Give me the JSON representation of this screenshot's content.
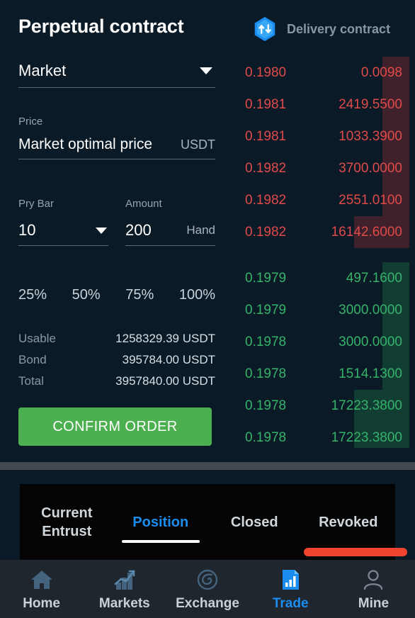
{
  "header": {
    "title": "Perpetual contract",
    "delivery_label": "Delivery contract",
    "delivery_icon": "swap-hexagon-icon",
    "accent_blue": "#1b8df0"
  },
  "form": {
    "order_type": {
      "label": "order-type",
      "value": "Market",
      "caret_icon": "chevron-down-icon"
    },
    "price": {
      "label": "Price",
      "value": "Market optimal price",
      "unit": "USDT"
    },
    "leverage": {
      "label": "Pry Bar",
      "value": "10",
      "caret_icon": "chevron-down-icon"
    },
    "amount": {
      "label": "Amount",
      "value": "200",
      "unit": "Hand"
    },
    "percent_options": [
      "25%",
      "50%",
      "75%",
      "100%"
    ],
    "balances": [
      {
        "key": "Usable",
        "value": "1258329.39 USDT"
      },
      {
        "key": "Bond",
        "value": "395784.00 USDT"
      },
      {
        "key": "Total",
        "value": "3957840.00 USDT"
      }
    ],
    "confirm_label": "CONFIRM ORDER",
    "confirm_color": "#4caf50"
  },
  "orderbook": {
    "ask_color": "#e04a4a",
    "bid_color": "#35b36a",
    "asks": [
      {
        "price": "0.1980",
        "amount": "0.0098"
      },
      {
        "price": "0.1981",
        "amount": "2419.5500"
      },
      {
        "price": "0.1981",
        "amount": "1033.3900"
      },
      {
        "price": "0.1982",
        "amount": "3700.0000"
      },
      {
        "price": "0.1982",
        "amount": "2551.0100"
      },
      {
        "price": "0.1982",
        "amount": "16142.6000"
      }
    ],
    "bids": [
      {
        "price": "0.1979",
        "amount": "497.1600"
      },
      {
        "price": "0.1979",
        "amount": "3000.0000"
      },
      {
        "price": "0.1978",
        "amount": "3000.0000"
      },
      {
        "price": "0.1978",
        "amount": "1514.1300"
      },
      {
        "price": "0.1978",
        "amount": "17223.3800"
      },
      {
        "price": "0.1978",
        "amount": "17223.3800"
      }
    ]
  },
  "order_tabs": [
    {
      "label": "Current Entrust",
      "active": false
    },
    {
      "label": "Position",
      "active": true
    },
    {
      "label": "Closed",
      "active": false
    },
    {
      "label": "Revoked",
      "active": false
    }
  ],
  "bottom_nav": [
    {
      "label": "Home",
      "icon": "home-icon",
      "active": false
    },
    {
      "label": "Markets",
      "icon": "chart-bars-icon",
      "active": false
    },
    {
      "label": "Exchange",
      "icon": "swirl-icon",
      "active": false
    },
    {
      "label": "Trade",
      "icon": "report-chart-icon",
      "active": true
    },
    {
      "label": "Mine",
      "icon": "person-icon",
      "active": false
    }
  ]
}
